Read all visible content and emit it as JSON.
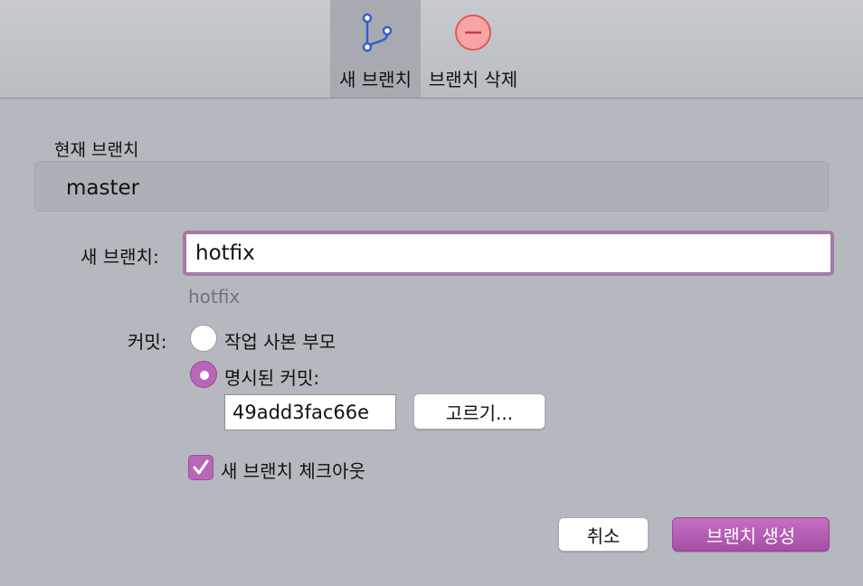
{
  "toolbar": {
    "new_branch_label": "새 브랜치",
    "delete_branch_label": "브랜치 삭제"
  },
  "current_branch": {
    "label": "현재 브랜치",
    "value": "master"
  },
  "new_branch": {
    "label": "새 브랜치:",
    "value": "hotfix",
    "hint": "hotfix"
  },
  "commit": {
    "label": "커밋:",
    "option_working_copy": "작업 사본 부모",
    "option_specified": "명시된 커밋:",
    "selected": "specified",
    "sha": "49add3fac66e",
    "choose_label": "고르기..."
  },
  "checkout": {
    "label": "새 브랜치 체크아웃",
    "checked": true
  },
  "actions": {
    "cancel_label": "취소",
    "create_label": "브랜치 생성"
  },
  "colors": {
    "accent": "#b866b8",
    "delete_icon": "#ef6b6b"
  }
}
